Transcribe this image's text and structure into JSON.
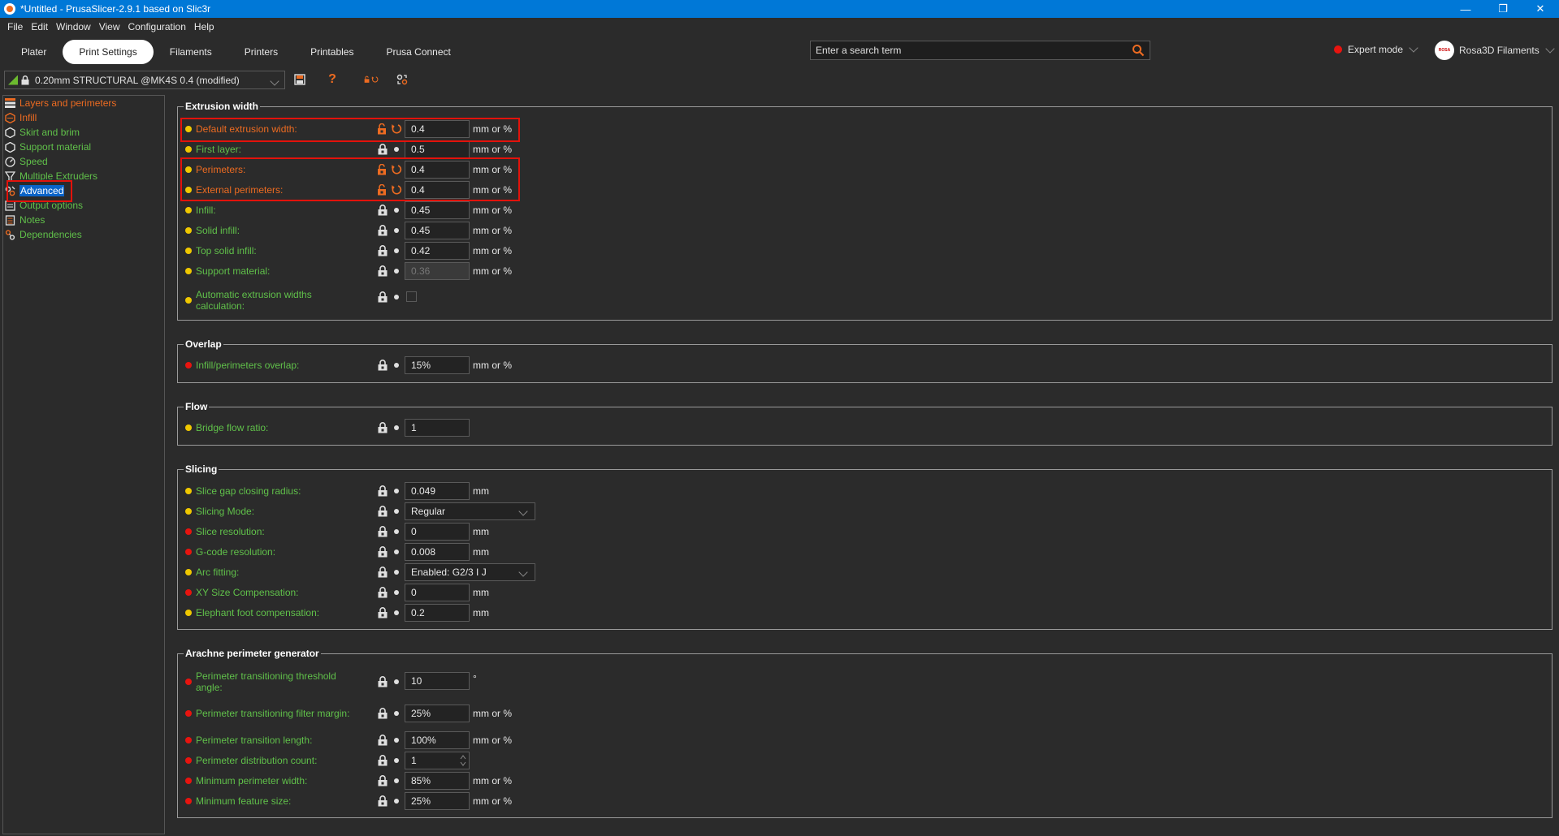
{
  "window": {
    "title": "*Untitled - PrusaSlicer-2.9.1 based on Slic3r"
  },
  "menu": [
    "File",
    "Edit",
    "Window",
    "View",
    "Configuration",
    "Help"
  ],
  "tabs": [
    "Plater",
    "Print Settings",
    "Filaments",
    "Printers",
    "Printables",
    "Prusa Connect"
  ],
  "search": {
    "placeholder": "Enter a search term"
  },
  "mode": {
    "label": "Expert mode"
  },
  "account": {
    "name": "Rosa3D Filaments",
    "avatar_text": "ROSA"
  },
  "preset": {
    "name": "0.20mm STRUCTURAL @MK4S 0.4 (modified)"
  },
  "sidebar": [
    "Layers and perimeters",
    "Infill",
    "Skirt and brim",
    "Support material",
    "Speed",
    "Multiple Extruders",
    "Advanced",
    "Output options",
    "Notes",
    "Dependencies"
  ],
  "groups": {
    "extrusion": {
      "title": "Extrusion width",
      "rows": [
        {
          "label": "Default extrusion width:",
          "value": "0.4",
          "unit": "mm or %"
        },
        {
          "label": "First layer:",
          "value": "0.5",
          "unit": "mm or %"
        },
        {
          "label": "Perimeters:",
          "value": "0.4",
          "unit": "mm or %"
        },
        {
          "label": "External perimeters:",
          "value": "0.4",
          "unit": "mm or %"
        },
        {
          "label": "Infill:",
          "value": "0.45",
          "unit": "mm or %"
        },
        {
          "label": "Solid infill:",
          "value": "0.45",
          "unit": "mm or %"
        },
        {
          "label": "Top solid infill:",
          "value": "0.42",
          "unit": "mm or %"
        },
        {
          "label": "Support material:",
          "value": "0.36",
          "unit": "mm or %"
        },
        {
          "label": "Automatic extrusion widths calculation:"
        }
      ]
    },
    "overlap": {
      "title": "Overlap",
      "rows": [
        {
          "label": "Infill/perimeters overlap:",
          "value": "15%",
          "unit": "mm or %"
        }
      ]
    },
    "flow": {
      "title": "Flow",
      "rows": [
        {
          "label": "Bridge flow ratio:",
          "value": "1"
        }
      ]
    },
    "slicing": {
      "title": "Slicing",
      "rows": [
        {
          "label": "Slice gap closing radius:",
          "value": "0.049",
          "unit": "mm"
        },
        {
          "label": "Slicing Mode:",
          "value": "Regular"
        },
        {
          "label": "Slice resolution:",
          "value": "0",
          "unit": "mm"
        },
        {
          "label": "G-code resolution:",
          "value": "0.008",
          "unit": "mm"
        },
        {
          "label": "Arc fitting:",
          "value": "Enabled: G2/3 I J"
        },
        {
          "label": "XY Size Compensation:",
          "value": "0",
          "unit": "mm"
        },
        {
          "label": "Elephant foot compensation:",
          "value": "0.2",
          "unit": "mm"
        }
      ]
    },
    "arachne": {
      "title": "Arachne perimeter generator",
      "rows": [
        {
          "label": "Perimeter transitioning threshold angle:",
          "value": "10",
          "unit": "°"
        },
        {
          "label": "Perimeter transitioning filter margin:",
          "value": "25%",
          "unit": "mm or %"
        },
        {
          "label": "Perimeter transition length:",
          "value": "100%",
          "unit": "mm or %"
        },
        {
          "label": "Perimeter distribution count:",
          "value": "1"
        },
        {
          "label": "Minimum perimeter width:",
          "value": "85%",
          "unit": "mm or %"
        },
        {
          "label": "Minimum feature size:",
          "value": "25%",
          "unit": "mm or %"
        }
      ]
    }
  },
  "colors": {
    "accent_orange": "#ed6b21",
    "label_green": "#60c04a",
    "highlight_red": "#e3120b",
    "titlebar_blue": "#0078d7"
  }
}
